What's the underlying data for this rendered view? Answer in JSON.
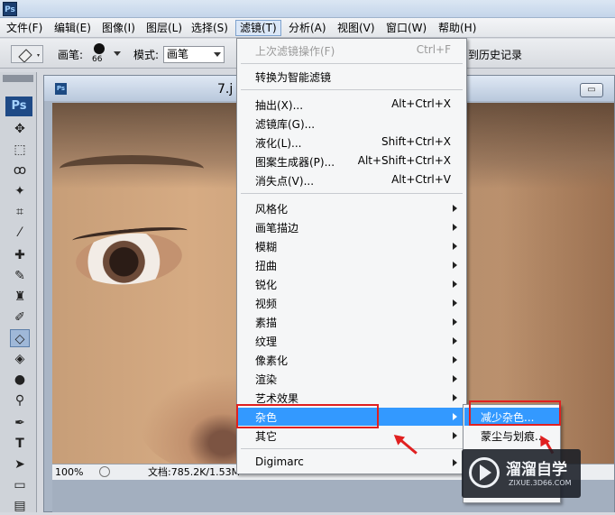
{
  "app": {
    "icon": "Ps"
  },
  "menubar": [
    "文件(F)",
    "编辑(E)",
    "图像(I)",
    "图层(L)",
    "选择(S)",
    "滤镜(T)",
    "分析(A)",
    "视图(V)",
    "窗口(W)",
    "帮助(H)"
  ],
  "options": {
    "brush_label": "画笔:",
    "brush_size": "66",
    "mode_label": "模式:",
    "mode_value": "画笔",
    "history_label": "到历史记录"
  },
  "toolbox": {
    "logo": "Ps"
  },
  "document": {
    "icon": "Ps",
    "name": "7.j",
    "zoom": "100%",
    "doc_info": "文档:785.2K/1.53M"
  },
  "filter_menu": {
    "items": [
      {
        "label": "上次滤镜操作(F)",
        "shortcut": "Ctrl+F",
        "disabled": true
      },
      {
        "label": "转换为智能滤镜",
        "shortcut": ""
      },
      {
        "label": "抽出(X)...",
        "shortcut": "Alt+Ctrl+X"
      },
      {
        "label": "滤镜库(G)...",
        "shortcut": ""
      },
      {
        "label": "液化(L)...",
        "shortcut": "Shift+Ctrl+X"
      },
      {
        "label": "图案生成器(P)...",
        "shortcut": "Alt+Shift+Ctrl+X"
      },
      {
        "label": "消失点(V)...",
        "shortcut": "Alt+Ctrl+V"
      },
      {
        "label": "风格化",
        "submenu": true
      },
      {
        "label": "画笔描边",
        "submenu": true
      },
      {
        "label": "模糊",
        "submenu": true
      },
      {
        "label": "扭曲",
        "submenu": true
      },
      {
        "label": "锐化",
        "submenu": true
      },
      {
        "label": "视频",
        "submenu": true
      },
      {
        "label": "素描",
        "submenu": true
      },
      {
        "label": "纹理",
        "submenu": true
      },
      {
        "label": "像素化",
        "submenu": true
      },
      {
        "label": "渲染",
        "submenu": true
      },
      {
        "label": "艺术效果",
        "submenu": true
      },
      {
        "label": "杂色",
        "submenu": true,
        "highlighted": true
      },
      {
        "label": "其它",
        "submenu": true
      },
      {
        "label": "Digimarc",
        "submenu": true
      }
    ]
  },
  "noise_submenu": {
    "items": [
      {
        "label": "减少杂色...",
        "highlighted": true
      },
      {
        "label": "蒙尘与划痕..."
      }
    ]
  },
  "watermark": {
    "title": "溜溜自学",
    "url": "ZIXUE.3D66.COM"
  },
  "colors": {
    "highlight": "#3399ff",
    "annotation": "#e02020"
  }
}
